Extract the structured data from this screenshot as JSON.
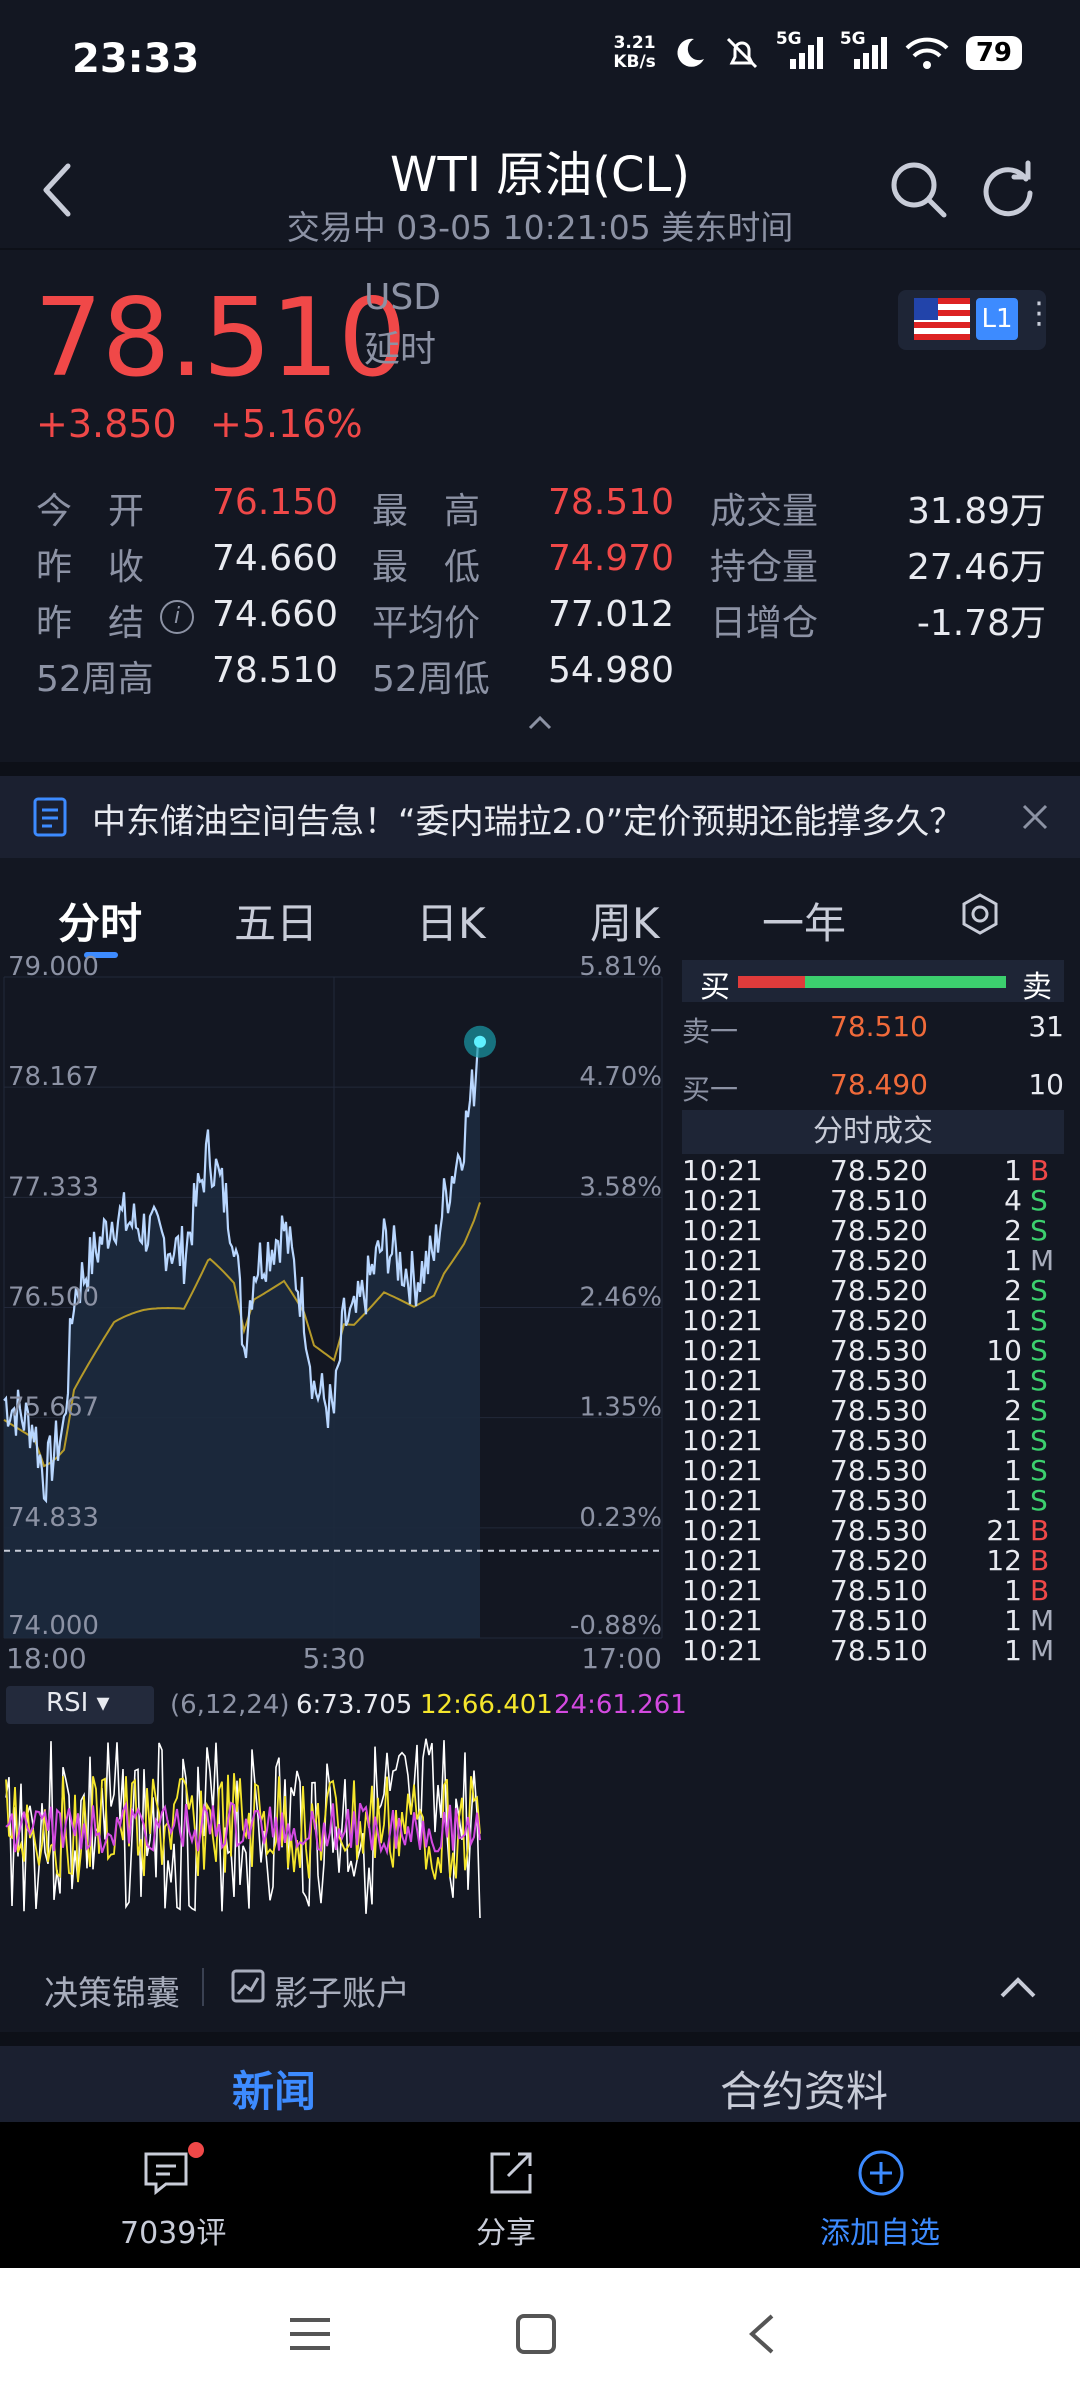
{
  "status": {
    "time": "23:33",
    "net_speed": "3.21",
    "net_unit": "KB/s",
    "sig1": "5G",
    "sig2": "5G",
    "battery": "79"
  },
  "header": {
    "title": "WTI 原油(CL)",
    "subtitle": "交易中 03-05 10:21:05 美东时间"
  },
  "quote": {
    "price": "78.510",
    "currency": "USD",
    "delay": "延时",
    "change": "+3.850",
    "change_pct": "+5.16%",
    "badge": "L1",
    "stats": [
      {
        "label": "今　开",
        "value": "76.150",
        "color": "red"
      },
      {
        "label": "最　高",
        "value": "78.510",
        "color": "red"
      },
      {
        "label": "成交量",
        "value": "31.89万",
        "color": "white"
      },
      {
        "label": "昨　收",
        "value": "74.660",
        "color": "white"
      },
      {
        "label": "最　低",
        "value": "74.970",
        "color": "red"
      },
      {
        "label": "持仓量",
        "value": "27.46万",
        "color": "white"
      },
      {
        "label": "昨　结",
        "value": "74.660",
        "color": "white"
      },
      {
        "label": "平均价",
        "value": "77.012",
        "color": "white"
      },
      {
        "label": "日增仓",
        "value": "-1.78万",
        "color": "white"
      },
      {
        "label": "52周高",
        "value": "78.510",
        "color": "white"
      },
      {
        "label": "52周低",
        "value": "54.980",
        "color": "white"
      }
    ]
  },
  "banner": {
    "text": "中东储油空间告急！“委内瑞拉2.0”定价预期还能撑多久？"
  },
  "chart_tabs": [
    "分时",
    "五日",
    "日K",
    "周K",
    "一年"
  ],
  "active_tab": "分时",
  "chart_data": {
    "type": "line",
    "y_left_ticks": [
      "79.000",
      "78.167",
      "77.333",
      "76.500",
      "75.667",
      "74.833",
      "74.000"
    ],
    "y_right_ticks": [
      "5.81%",
      "4.70%",
      "3.58%",
      "2.46%",
      "1.35%",
      "0.23%",
      "-0.88%"
    ],
    "x_ticks": [
      "18:00",
      "5:30",
      "17:00"
    ],
    "ylim": [
      74.0,
      79.0
    ],
    "prev_close": 74.66,
    "last": 78.51
  },
  "rsi": {
    "label": "RSI ▾",
    "params": "(6,12,24)",
    "rsi6": "6:73.705",
    "rsi12": "12:66.401",
    "rsi24": "24:61.261"
  },
  "orderbook": {
    "buy_label": "买",
    "sell_label": "卖",
    "buy_ratio": 0.25,
    "ask": {
      "label": "卖一",
      "price": "78.510",
      "qty": "31"
    },
    "bid": {
      "label": "买一",
      "price": "78.490",
      "qty": "10"
    },
    "trades_title": "分时成交",
    "trades": [
      {
        "t": "10:21",
        "p": "78.520",
        "q": "1",
        "s": "B"
      },
      {
        "t": "10:21",
        "p": "78.510",
        "q": "4",
        "s": "S"
      },
      {
        "t": "10:21",
        "p": "78.520",
        "q": "2",
        "s": "S"
      },
      {
        "t": "10:21",
        "p": "78.520",
        "q": "1",
        "s": "M"
      },
      {
        "t": "10:21",
        "p": "78.520",
        "q": "2",
        "s": "S"
      },
      {
        "t": "10:21",
        "p": "78.520",
        "q": "1",
        "s": "S"
      },
      {
        "t": "10:21",
        "p": "78.530",
        "q": "10",
        "s": "S"
      },
      {
        "t": "10:21",
        "p": "78.530",
        "q": "1",
        "s": "S"
      },
      {
        "t": "10:21",
        "p": "78.530",
        "q": "2",
        "s": "S"
      },
      {
        "t": "10:21",
        "p": "78.530",
        "q": "1",
        "s": "S"
      },
      {
        "t": "10:21",
        "p": "78.530",
        "q": "1",
        "s": "S"
      },
      {
        "t": "10:21",
        "p": "78.530",
        "q": "1",
        "s": "S"
      },
      {
        "t": "10:21",
        "p": "78.530",
        "q": "21",
        "s": "B"
      },
      {
        "t": "10:21",
        "p": "78.520",
        "q": "12",
        "s": "B"
      },
      {
        "t": "10:21",
        "p": "78.510",
        "q": "1",
        "s": "B"
      },
      {
        "t": "10:21",
        "p": "78.510",
        "q": "1",
        "s": "M"
      },
      {
        "t": "10:21",
        "p": "78.510",
        "q": "1",
        "s": "M"
      }
    ]
  },
  "tools": {
    "tool1": "决策锦囊",
    "tool2": "影子账户"
  },
  "section_tabs": {
    "news": "新闻",
    "contract": "合约资料"
  },
  "bottom": {
    "comments": "7039评",
    "share": "分享",
    "watch": "添加自选"
  },
  "colors": {
    "up": "#f04848",
    "down": "#3ccf6e",
    "accent": "#3d8bff",
    "bg": "#131722"
  }
}
